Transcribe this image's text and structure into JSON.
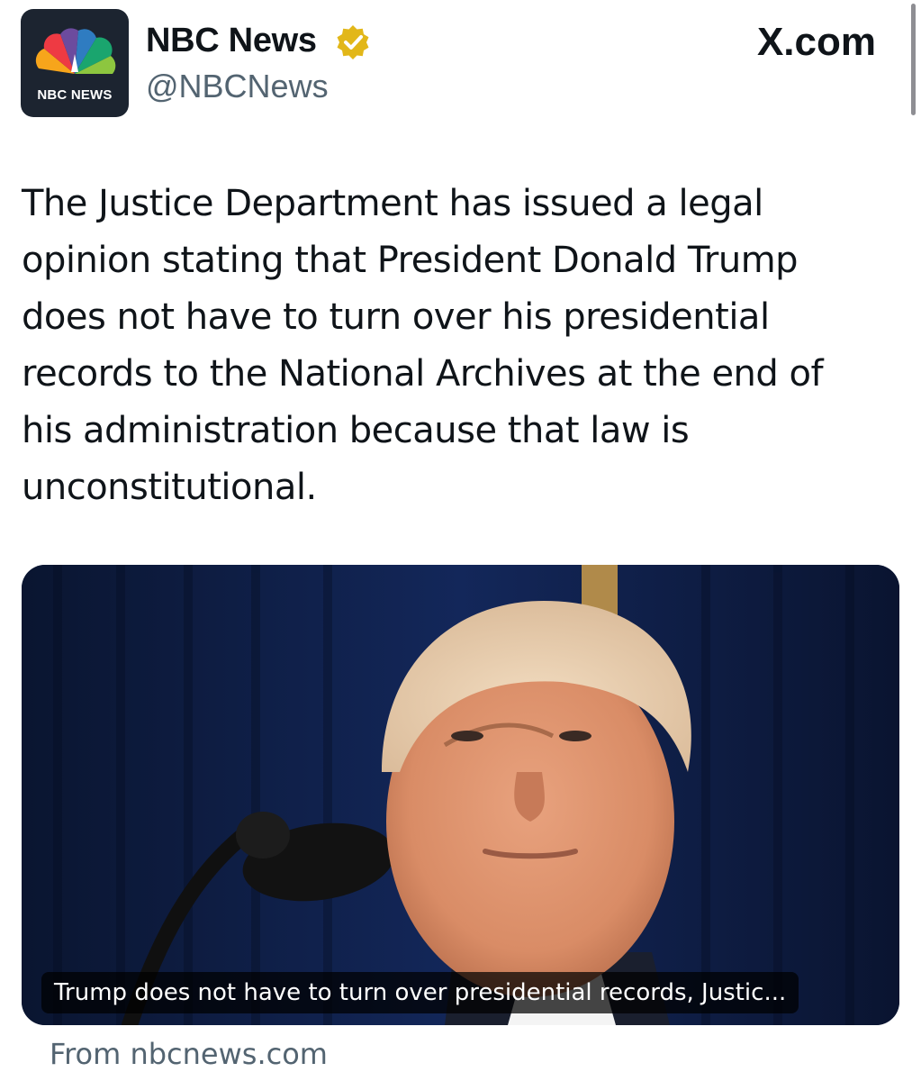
{
  "header": {
    "display_name": "NBC News",
    "handle": "@NBCNews",
    "site_label": "X.com",
    "avatar_text": "NBC NEWS",
    "verified_icon": "verified-gold-check-icon"
  },
  "tweet": {
    "text": "The Justice Department has issued a legal opinion stating that President Donald Trump does not have to turn over his presidential records to the National Archives at the end of his administration because that law is unconstitutional."
  },
  "card": {
    "caption": "Trump does not have to turn over presidential records, Justic...",
    "source": "From nbcnews.com",
    "image": "photo-of-donald-trump-at-microphone"
  },
  "colors": {
    "text_primary": "#0f1419",
    "text_secondary": "#536471",
    "verified_gold": "#e2b719",
    "card_background": "#0b1838"
  }
}
